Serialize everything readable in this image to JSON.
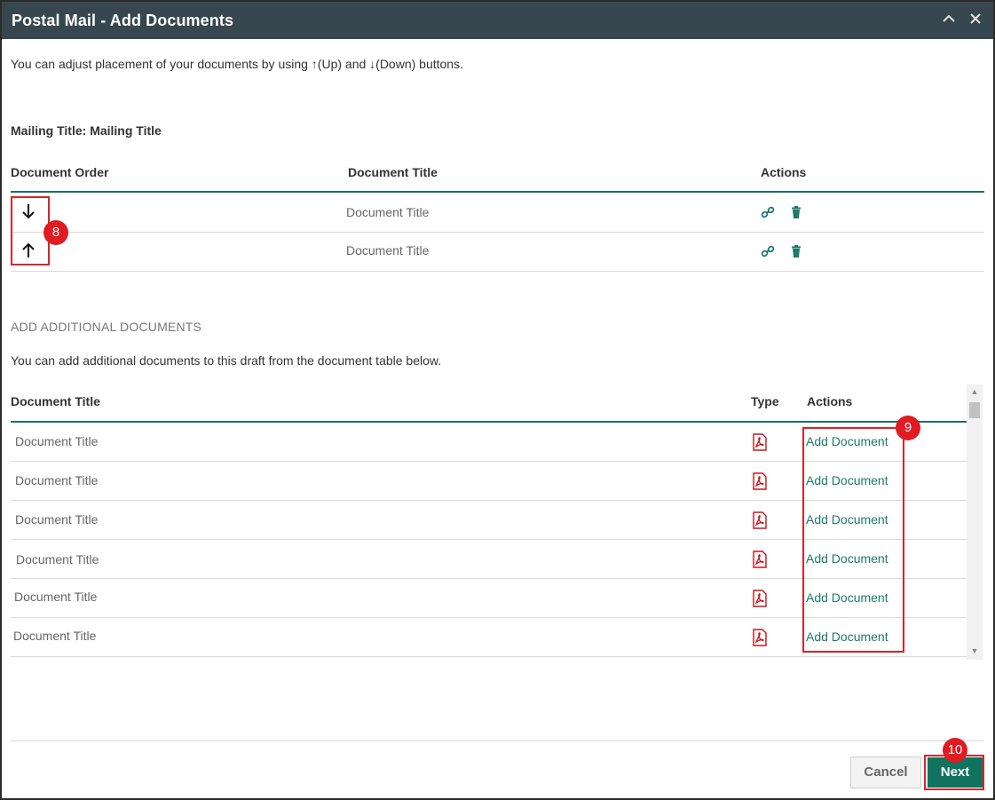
{
  "dialog": {
    "title": "Postal Mail - Add Documents",
    "intro": "You can adjust placement of your documents by using ↑(Up) and ↓(Down) buttons.",
    "mailing_title": "Mailing Title: Mailing Title"
  },
  "order_table": {
    "headers": [
      "Document Order",
      "Document Title",
      "Actions"
    ],
    "rows": [
      {
        "title": "Document Title",
        "order_icon": "arrow-down-icon"
      },
      {
        "title": "Document Title",
        "order_icon": "arrow-up-icon"
      }
    ]
  },
  "additional": {
    "heading": "ADD ADDITIONAL DOCUMENTS",
    "description": "You can add additional documents to this draft from the document table below.",
    "headers": [
      "Document Title",
      "Type",
      "Actions"
    ],
    "rows": [
      {
        "title": "Document Title",
        "type": "pdf-icon",
        "action": "Add Document"
      },
      {
        "title": "Document Title",
        "type": "pdf-icon",
        "action": "Add Document"
      },
      {
        "title": "Document Title",
        "type": "pdf-icon",
        "action": "Add Document"
      },
      {
        "title": "Document Title",
        "type": "pdf-icon",
        "action": "Add Document"
      },
      {
        "title": "Document Title",
        "type": "pdf-icon",
        "action": "Add Document"
      },
      {
        "title": "Document Title",
        "type": "pdf-icon",
        "action": "Add Document"
      }
    ]
  },
  "annotations": {
    "badge_order": "8",
    "badge_add": "9",
    "badge_next": "10"
  },
  "footer": {
    "cancel_label": "Cancel",
    "next_label": "Next"
  },
  "colors": {
    "titlebar": "#37474f",
    "accent": "#10735f",
    "callout": "#d9242b"
  }
}
